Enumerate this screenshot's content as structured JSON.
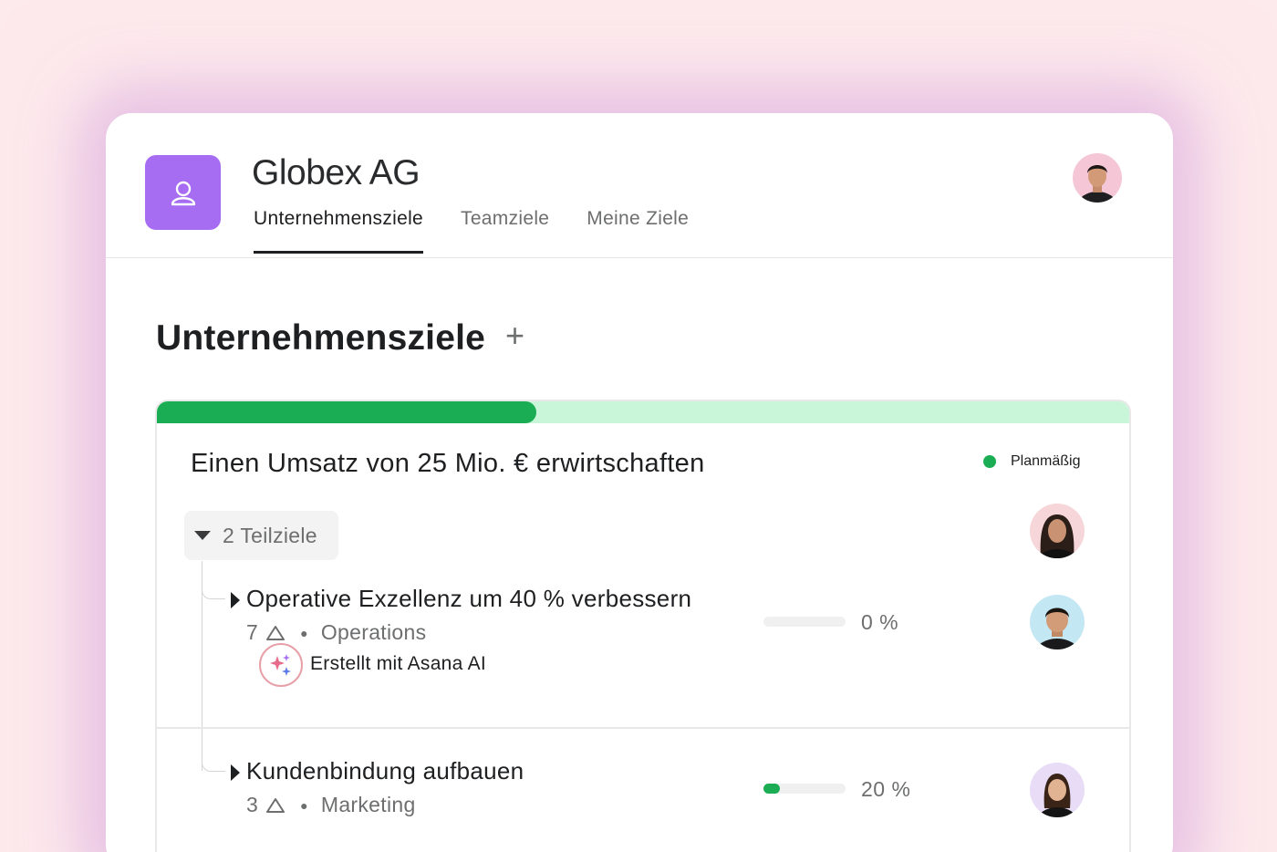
{
  "company": {
    "name": "Globex AG",
    "logo_icon": "people-icon",
    "logo_color": "#a66cf2"
  },
  "tabs": [
    {
      "label": "Unternehmensziele",
      "active": true
    },
    {
      "label": "Teamziele",
      "active": false
    },
    {
      "label": "Meine Ziele",
      "active": false
    }
  ],
  "page": {
    "title": "Unternehmensziele",
    "add_label": "+"
  },
  "goal": {
    "title": "Einen Umsatz von 25 Mio. € erwirtschaften",
    "progress_fraction": 0.39,
    "status_label": "Planmäßig",
    "status_color": "#1aad53",
    "subgoals_label": "2 Teilziele",
    "subgoals": [
      {
        "title": "Operative Exzellenz um 40 % verbessern",
        "count": "7",
        "team": "Operations",
        "progress": 0,
        "percent_label": "0 %",
        "ai_label": "Erstellt mit Asana AI"
      },
      {
        "title": "Kundenbindung aufbauen",
        "count": "3",
        "team": "Marketing",
        "progress": 20,
        "percent_label": "20 %"
      }
    ]
  }
}
